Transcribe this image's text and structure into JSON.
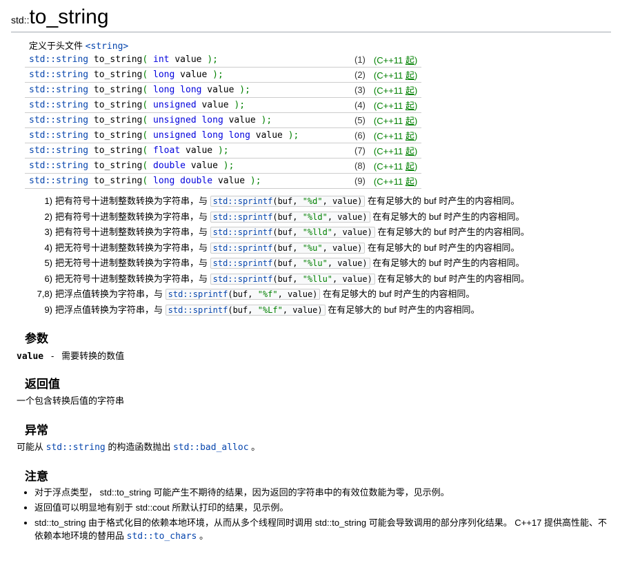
{
  "title_prefix": "std::",
  "title_name": "to_string",
  "header_prefix": "定义于头文件 ",
  "header_link": "<string>",
  "signatures": [
    {
      "ret": "std::string",
      "fn": "to_string",
      "argtype": "int",
      "arg": "value",
      "num": "(1)",
      "ver": "(C++11 起)"
    },
    {
      "ret": "std::string",
      "fn": "to_string",
      "argtype": "long",
      "arg": "value",
      "num": "(2)",
      "ver": "(C++11 起)"
    },
    {
      "ret": "std::string",
      "fn": "to_string",
      "argtype": "long long",
      "arg": "value",
      "num": "(3)",
      "ver": "(C++11 起)"
    },
    {
      "ret": "std::string",
      "fn": "to_string",
      "argtype": "unsigned",
      "arg": "value",
      "num": "(4)",
      "ver": "(C++11 起)"
    },
    {
      "ret": "std::string",
      "fn": "to_string",
      "argtype": "unsigned long",
      "arg": "value",
      "num": "(5)",
      "ver": "(C++11 起)"
    },
    {
      "ret": "std::string",
      "fn": "to_string",
      "argtype": "unsigned long long",
      "arg": "value",
      "num": "(6)",
      "ver": "(C++11 起)"
    },
    {
      "ret": "std::string",
      "fn": "to_string",
      "argtype": "float",
      "arg": "value",
      "num": "(7)",
      "ver": "(C++11 起)"
    },
    {
      "ret": "std::string",
      "fn": "to_string",
      "argtype": "double",
      "arg": "value",
      "num": "(8)",
      "ver": "(C++11 起)"
    },
    {
      "ret": "std::string",
      "fn": "to_string",
      "argtype": "long double",
      "arg": "value",
      "num": "(9)",
      "ver": "(C++11 起)"
    }
  ],
  "descriptions": [
    {
      "num": "1)",
      "before": "把有符号十进制整数转换为字符串，与 ",
      "fn": "std::sprintf",
      "arg1": "buf",
      "fmt": "\"%d\"",
      "arg2": "value",
      "after": " 在有足够大的 buf 时产生的内容相同。"
    },
    {
      "num": "2)",
      "before": "把有符号十进制整数转换为字符串，与 ",
      "fn": "std::sprintf",
      "arg1": "buf",
      "fmt": "\"%ld\"",
      "arg2": "value",
      "after": " 在有足够大的 buf 时产生的内容相同。"
    },
    {
      "num": "3)",
      "before": "把有符号十进制整数转换为字符串，与 ",
      "fn": "std::sprintf",
      "arg1": "buf",
      "fmt": "\"%lld\"",
      "arg2": "value",
      "after": " 在有足够大的 buf 时产生的内容相同。"
    },
    {
      "num": "4)",
      "before": "把无符号十进制整数转换为字符串，与 ",
      "fn": "std::sprintf",
      "arg1": "buf",
      "fmt": "\"%u\"",
      "arg2": "value",
      "after": " 在有足够大的 buf 时产生的内容相同。"
    },
    {
      "num": "5)",
      "before": "把无符号十进制整数转换为字符串，与 ",
      "fn": "std::sprintf",
      "arg1": "buf",
      "fmt": "\"%lu\"",
      "arg2": "value",
      "after": " 在有足够大的 buf 时产生的内容相同。"
    },
    {
      "num": "6)",
      "before": "把无符号十进制整数转换为字符串，与 ",
      "fn": "std::sprintf",
      "arg1": "buf",
      "fmt": "\"%llu\"",
      "arg2": "value",
      "after": " 在有足够大的 buf 时产生的内容相同。"
    },
    {
      "num": "7,8)",
      "before": "把浮点值转换为字符串，与 ",
      "fn": "std::sprintf",
      "arg1": "buf",
      "fmt": "\"%f\"",
      "arg2": "value",
      "after": " 在有足够大的 buf 时产生的内容相同。"
    },
    {
      "num": "9)",
      "before": "把浮点值转换为字符串，与 ",
      "fn": "std::sprintf",
      "arg1": "buf",
      "fmt": "\"%Lf\"",
      "arg2": "value",
      "after": " 在有足够大的 buf 时产生的内容相同。"
    }
  ],
  "sections": {
    "params_h": "参数",
    "return_h": "返回值",
    "except_h": "异常",
    "notes_h": "注意"
  },
  "params": {
    "name": "value",
    "sep": "-",
    "desc": "需要转换的数值"
  },
  "return_text": "一个包含转换后值的字符串",
  "except": {
    "before": "可能从 ",
    "link1": "std::string",
    "mid": " 的构造函数抛出 ",
    "link2": "std::bad_alloc",
    "after": " 。"
  },
  "notes": [
    {
      "before": "对于浮点类型， std::to_string 可能产生不期待的结果，因为返回的字符串中的有效位数能为零，见示例。"
    },
    {
      "before": "返回值可以明显地有别于 std::cout 所默认打印的结果，见示例。"
    },
    {
      "before": "std::to_string 由于格式化目的依赖本地环境，从而从多个线程同时调用 std::to_string 可能会导致调用的部分序列化结果。 C++17 提供高性能、不依赖本地环境的替用品 ",
      "link": "std::to_chars",
      "after": " 。"
    }
  ]
}
